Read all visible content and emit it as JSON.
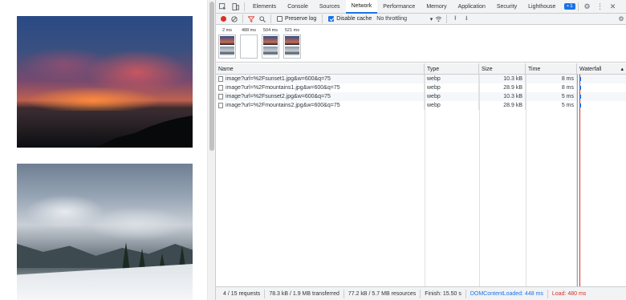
{
  "devtools": {
    "tabs": [
      "Elements",
      "Console",
      "Sources",
      "Network",
      "Performance",
      "Memory",
      "Application",
      "Security",
      "Lighthouse"
    ],
    "active_tab": "Network",
    "issues_badge": "1",
    "toolbar": {
      "preserve_log_label": "Preserve log",
      "preserve_log_checked": false,
      "disable_cache_label": "Disable cache",
      "disable_cache_checked": true,
      "throttling_value": "No throttling"
    },
    "filmstrip": [
      {
        "time": "2 ms"
      },
      {
        "time": "488 ms"
      },
      {
        "time": "504 ms"
      },
      {
        "time": "521 ms"
      }
    ],
    "table": {
      "headers": {
        "name": "Name",
        "type": "Type",
        "size": "Size",
        "time": "Time",
        "waterfall": "Waterfall"
      },
      "rows": [
        {
          "name": "image?url=%2Fsunset1.jpg&w=600&q=75",
          "type": "webp",
          "size": "10.3 kB",
          "time": "8 ms"
        },
        {
          "name": "image?url=%2Fmountains1.jpg&w=600&q=75",
          "type": "webp",
          "size": "28.9 kB",
          "time": "8 ms"
        },
        {
          "name": "image?url=%2Fsunset2.jpg&w=600&q=75",
          "type": "webp",
          "size": "10.3 kB",
          "time": "5 ms"
        },
        {
          "name": "image?url=%2Fmountains2.jpg&w=600&q=75",
          "type": "webp",
          "size": "28.9 kB",
          "time": "5 ms"
        }
      ]
    },
    "status": {
      "requests": "4 / 15 requests",
      "transferred": "78.3 kB / 1.9 MB transferred",
      "resources": "77.2 kB / 5.7 MB resources",
      "finish": "Finish: 15.50 s",
      "dcl": "DOMContentLoaded: 448 ms",
      "load": "Load: 480 ms"
    },
    "colors": {
      "accent": "#1a73e8",
      "record": "#d93025",
      "load_line": "#d93025"
    }
  }
}
